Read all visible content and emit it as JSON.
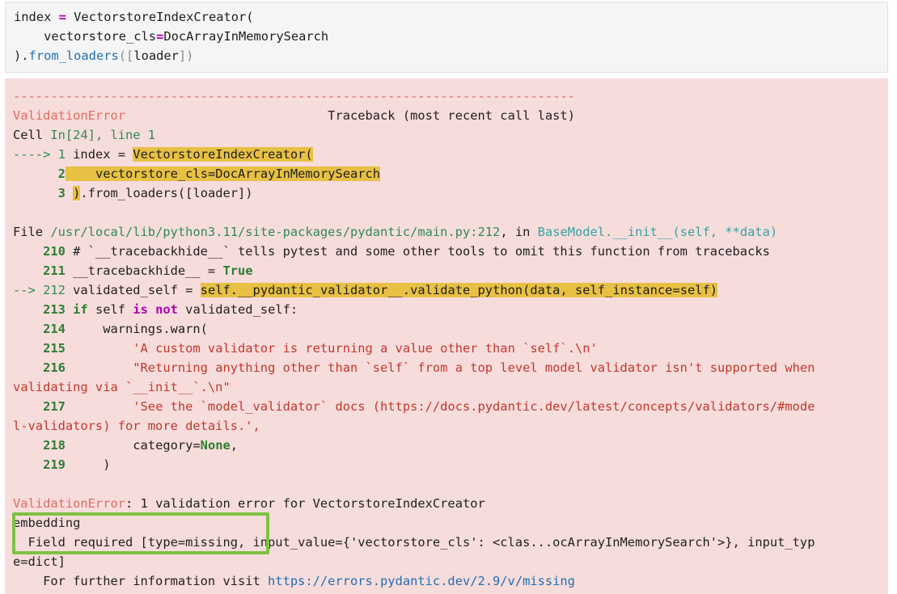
{
  "input_cell": {
    "lines": [
      [
        "index ",
        "=",
        " VectorstoreIndexCreator("
      ],
      [
        "    vectorstore_cls",
        "=",
        "DocArrayInMemorySearch"
      ],
      [
        ").",
        "from_loaders",
        "([",
        "loader",
        "])"
      ]
    ]
  },
  "traceback": {
    "separator": "---------------------------------------------------------------------------",
    "error_name": "ValidationError",
    "traceback_header": "                           Traceback (most recent call last)",
    "cell_prefix": "Cell ",
    "cell_ref": "In[24], line 1",
    "cell_lines": [
      {
        "arrow": "----> ",
        "num": "1",
        "pre": " index = ",
        "hl": "VectorstoreIndexCreator("
      },
      {
        "arrow": "      ",
        "num": "2",
        "pre": " ",
        "hl": "   vectorstore_cls=DocArrayInMemorySearch"
      },
      {
        "arrow": "      ",
        "num": "3",
        "pre": " ",
        "hl": ")",
        "post": ".from_loaders([loader])"
      }
    ],
    "file_prefix": "File ",
    "file_path": "/usr/local/lib/python3.11/site-packages/pydantic/main.py:212",
    "file_in": ", in ",
    "func_name": "BaseModel.__init__(self, **data)",
    "src": {
      "l210_num": "    210",
      "l210_text": " # `__tracebackhide__` tells pytest and some other tools to omit this function from tracebacks",
      "l211_num": "    211",
      "l211_text": " __tracebackhide__ = ",
      "l211_true": "True",
      "l212_arrow": "--> ",
      "l212_num": "212",
      "l212_pre": " validated_self = ",
      "l212_hl": "self.__pydantic_validator__.validate_python(data, self_instance=self)",
      "l213_num": "    213",
      "l213_if": " if",
      "l213_mid1": " self ",
      "l213_isnot": "is not",
      "l213_rest": " validated_self:",
      "l214_num": "    214",
      "l214_text": "     warnings.warn(",
      "l215_num": "    215",
      "l215_text": "         'A custom validator is returning a value other than `self`.\\n'",
      "l216_num": "    216",
      "l216_text": "         \"Returning anything other than `self` from a top level model validator isn't supported when",
      "l216_cont": "validating via `__init__`.\\n\"",
      "l217_num": "    217",
      "l217_text": "         'See the `model_validator` docs (https://docs.pydantic.dev/latest/concepts/validators/#mode",
      "l217_cont": "l-validators) for more details.',",
      "l218_num": "    218",
      "l218_pre": "         category=",
      "l218_none": "None",
      "l218_post": ",",
      "l219_num": "    219",
      "l219_text": "     )"
    },
    "summary_name": "ValidationError",
    "summary_text": ": 1 validation error for VectorstoreIndexCreator",
    "field": "embedding",
    "field_detail": "  Field required [type=missing, input_value={'vectorstore_cls': <clas...ocArrayInMemorySearch'>}, input_typ",
    "field_detail_cont": "e=dict]",
    "info_prefix": "    For further information visit ",
    "info_url": "https://errors.pydantic.dev/2.9/v/missing"
  }
}
